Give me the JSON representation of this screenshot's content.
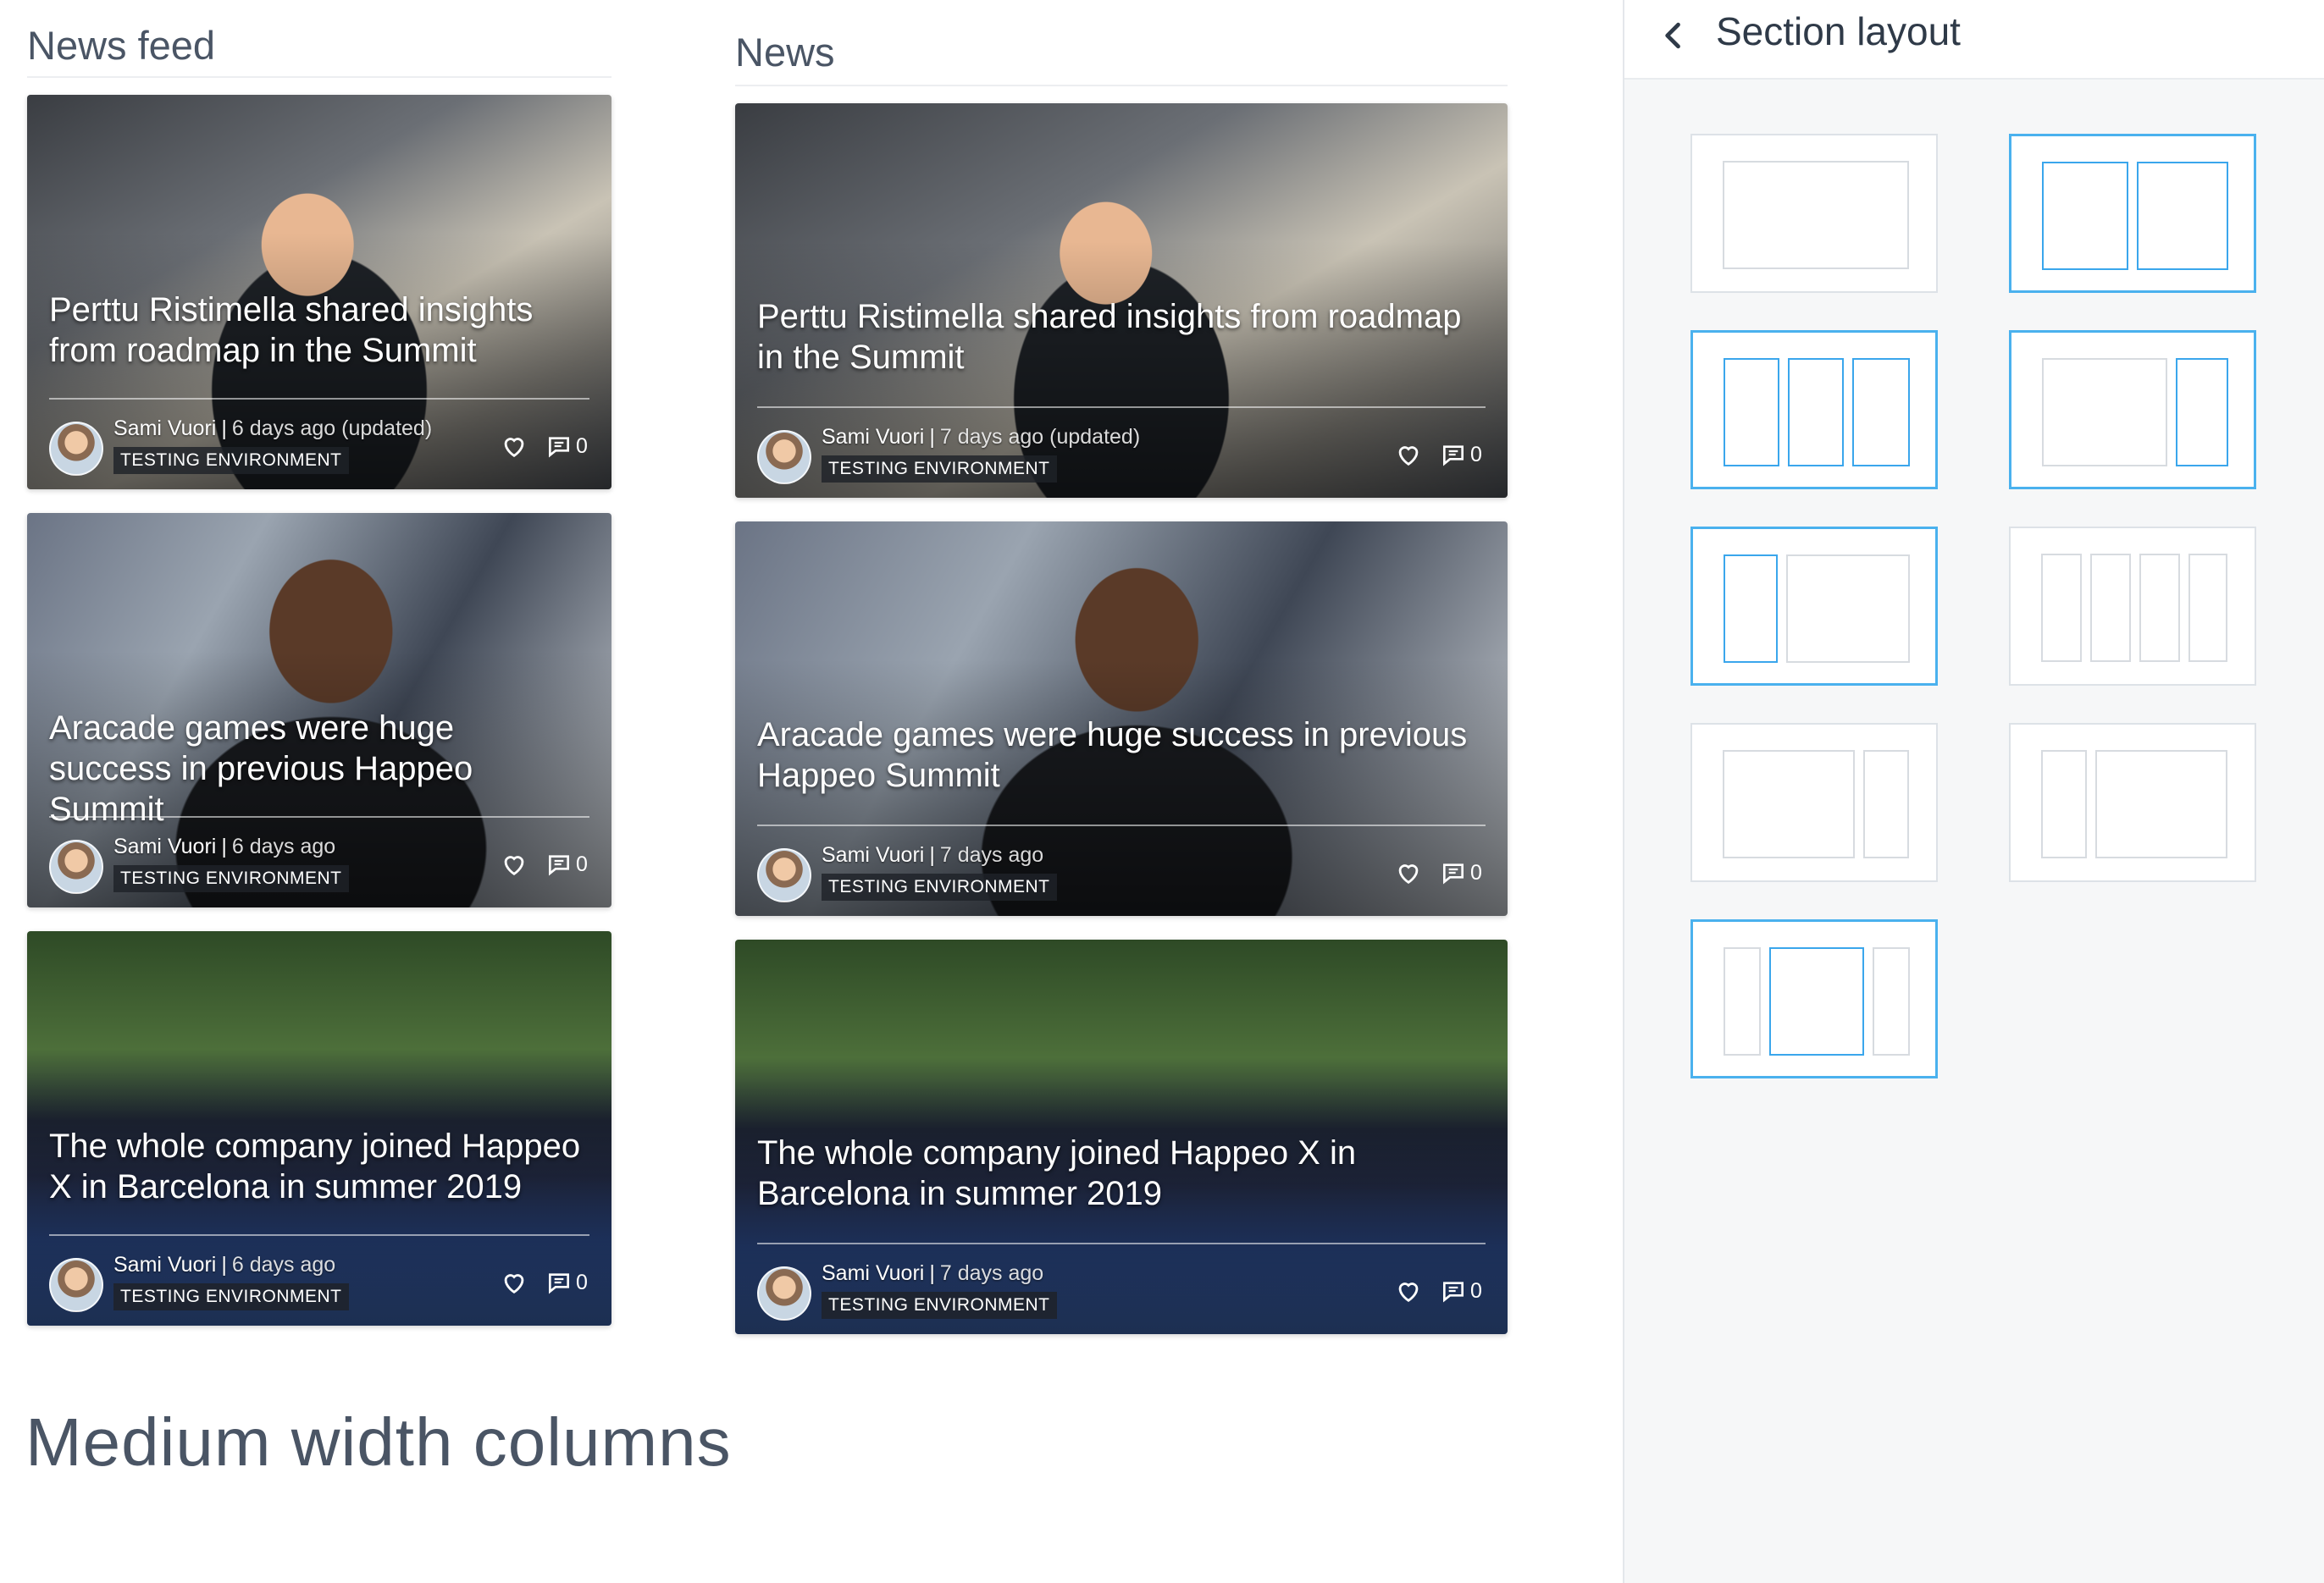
{
  "columns": [
    {
      "title": "News feed",
      "cards": [
        {
          "title": "Perttu Ristimella shared insights from roadmap in the Summit",
          "author": "Sami Vuori",
          "time": "6 days ago",
          "extra": "(updated)",
          "tag": "TESTING ENVIRONMENT",
          "comments": "0"
        },
        {
          "title": "Aracade games were huge success in previous Happeo Summit",
          "author": "Sami Vuori",
          "time": "6 days ago",
          "extra": "",
          "tag": "TESTING ENVIRONMENT",
          "comments": "0"
        },
        {
          "title": "The whole company joined Happeo X in Barcelona in summer 2019",
          "author": "Sami Vuori",
          "time": "6 days ago",
          "extra": "",
          "tag": "TESTING ENVIRONMENT",
          "comments": "0"
        }
      ]
    },
    {
      "title": "News",
      "cards": [
        {
          "title": "Perttu Ristimella shared insights from roadmap in the Summit",
          "author": "Sami Vuori",
          "time": "7 days ago",
          "extra": "(updated)",
          "tag": "TESTING ENVIRONMENT",
          "comments": "0"
        },
        {
          "title": "Aracade games were huge success in previous Happeo Summit",
          "author": "Sami Vuori",
          "time": "7 days ago",
          "extra": "",
          "tag": "TESTING ENVIRONMENT",
          "comments": "0"
        },
        {
          "title": "The whole company joined Happeo X in Barcelona in summer 2019",
          "author": "Sami Vuori",
          "time": "7 days ago",
          "extra": "",
          "tag": "TESTING ENVIRONMENT",
          "comments": "0"
        }
      ]
    }
  ],
  "section_heading": "Medium width columns",
  "panel": {
    "title": "Section layout",
    "back_icon": "chevron-left-icon",
    "options": [
      {
        "name": "one-column",
        "selected": false
      },
      {
        "name": "two-equal-columns",
        "selected": true
      },
      {
        "name": "three-equal-columns",
        "selected": true
      },
      {
        "name": "wide-left-narrow-right",
        "selected": true
      },
      {
        "name": "narrow-left-wide-right",
        "selected": true
      },
      {
        "name": "four-equal-columns",
        "selected": false
      },
      {
        "name": "wide-left-narrow-right-alt",
        "selected": false
      },
      {
        "name": "narrow-left-wide-right-alt",
        "selected": false
      },
      {
        "name": "narrow-wide-narrow",
        "selected": true
      }
    ]
  },
  "colors": {
    "accent": "#3aa6ec",
    "panel_bg": "#f6f7f8"
  }
}
